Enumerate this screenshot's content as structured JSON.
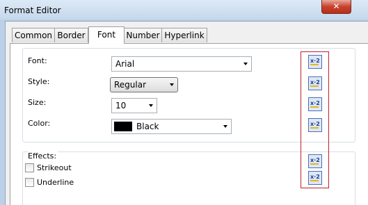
{
  "window": {
    "title": "Format Editor",
    "close_glyph": "✕"
  },
  "tabs": [
    {
      "label": "Common"
    },
    {
      "label": "Border"
    },
    {
      "label": "Font",
      "active": true
    },
    {
      "label": "Number"
    },
    {
      "label": "Hyperlink"
    }
  ],
  "font_group": {
    "font": {
      "label": "Font:",
      "value": "Arial"
    },
    "style": {
      "label": "Style:",
      "value": "Regular"
    },
    "size": {
      "label": "Size:",
      "value": "10"
    },
    "color": {
      "label": "Color:",
      "value": "Black",
      "swatch": "#000000"
    }
  },
  "effects": {
    "title": "Effects:",
    "strikeout": {
      "label": "Strikeout",
      "checked": false
    },
    "underline": {
      "label": "Underline",
      "checked": false
    }
  },
  "formula_buttons": {
    "icon": "formula-editor-icon",
    "text": "x·2",
    "count": 6
  },
  "colors": {
    "highlight_box": "#c0202a",
    "close_button": "#c8422d"
  }
}
